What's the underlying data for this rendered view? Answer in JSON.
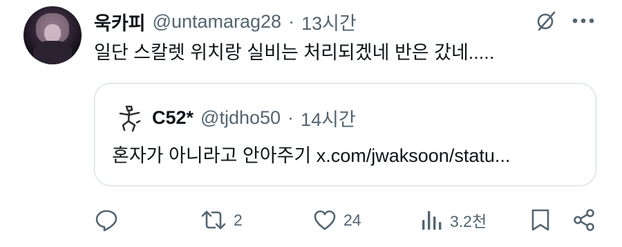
{
  "tweet": {
    "author_name": "욱카피",
    "author_handle": "@untamarag28",
    "separator": "·",
    "time": "13시간",
    "text": "일단 스칼렛 위치랑 실비는 처리되겠네 반은 갔네....."
  },
  "quote": {
    "author_name": "C52*",
    "author_handle": "@tjdho50",
    "separator": "·",
    "time": "14시간",
    "text": "혼자가 아니라고 안아주기 x.com/jwaksoon/statu..."
  },
  "actions": {
    "retweets": "2",
    "likes": "24",
    "views": "3.2천"
  },
  "icons": {
    "grok": "grok-icon",
    "more": "more-icon",
    "reply": "reply-icon",
    "retweet": "retweet-icon",
    "like": "heart-icon",
    "views": "views-icon",
    "bookmark": "bookmark-icon",
    "share": "share-icon"
  },
  "colors": {
    "text": "#0f1419",
    "secondary": "#536471",
    "border": "#cfd9de"
  }
}
